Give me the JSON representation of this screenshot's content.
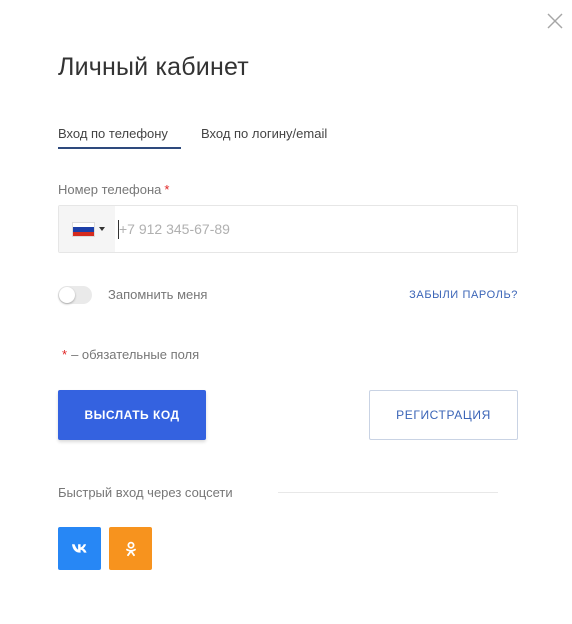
{
  "dialog": {
    "title": "Личный кабинет",
    "close_icon": "close-icon"
  },
  "tabs": [
    {
      "label": "Вход по телефону",
      "active": true
    },
    {
      "label": "Вход по логину/email",
      "active": false
    }
  ],
  "phone": {
    "label": "Номер телефона",
    "required_mark": "*",
    "country_flag": "russia-flag-icon",
    "placeholder": "+7 912 345-67-89",
    "value": ""
  },
  "remember": {
    "label": "Запомнить меня",
    "enabled": false
  },
  "forgot_link": "ЗАБЫЛИ ПАРОЛЬ?",
  "required_note": {
    "mark": "*",
    "text": "– обязательные поля"
  },
  "buttons": {
    "send_code": "ВЫСЛАТЬ КОД",
    "register": "РЕГИСТРАЦИЯ"
  },
  "social": {
    "label": "Быстрый вход через соцсети",
    "items": [
      {
        "name": "vk-icon",
        "color": "#2787f5"
      },
      {
        "name": "odnoklassniki-icon",
        "color": "#f7931e"
      }
    ]
  },
  "colors": {
    "primary": "#3462e0",
    "link": "#3a64b7",
    "required": "#e02424",
    "tab_underline": "#2e4a7d"
  }
}
